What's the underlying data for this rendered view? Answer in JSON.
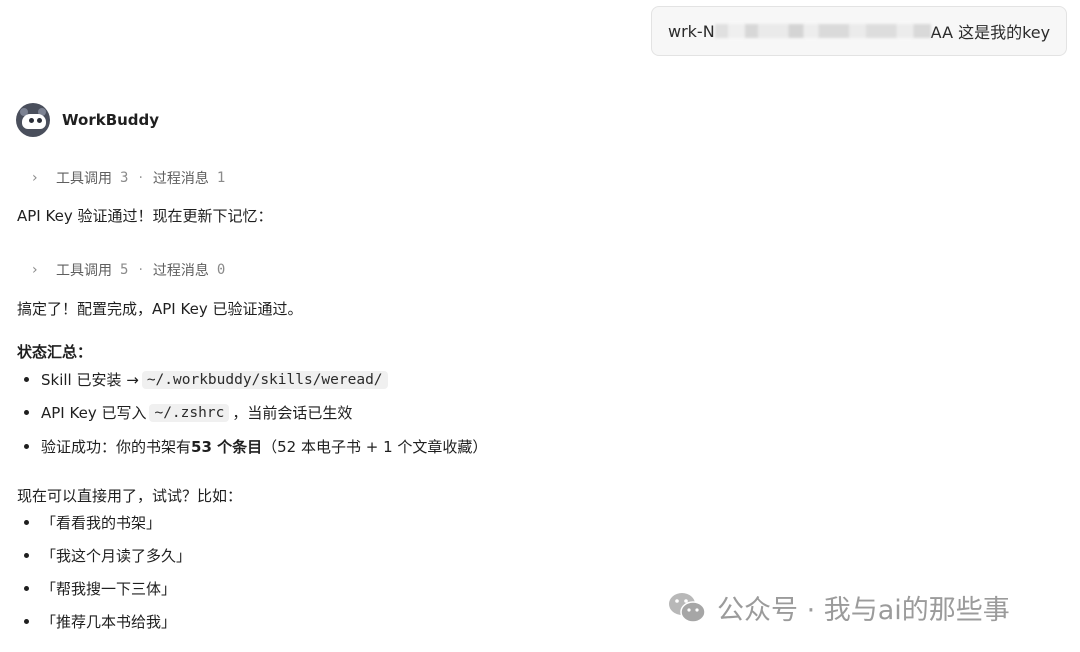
{
  "user_message": {
    "prefix": "wrk-N",
    "suffix": "AA 这是我的key"
  },
  "assistant": {
    "name": "WorkBuddy",
    "avatar_icon": "robot-avatar-icon"
  },
  "tool_rows": [
    {
      "label_calls": "工具调用",
      "calls": "3",
      "label_msgs": "过程消息",
      "msgs": "1"
    },
    {
      "label_calls": "工具调用",
      "calls": "5",
      "label_msgs": "过程消息",
      "msgs": "0"
    }
  ],
  "messages": {
    "verify_line": "API Key 验证通过！现在更新下记忆：",
    "done_line": "搞定了！配置完成，API Key 已验证通过。",
    "status_heading": "状态汇总：",
    "status_items": [
      {
        "before": "Skill 已安装 → ",
        "code": "~/.workbuddy/skills/weread/",
        "after": ""
      },
      {
        "before": "API Key 已写入 ",
        "code": "~/.zshrc",
        "after": "，当前会话已生效"
      },
      {
        "before": "验证成功：你的书架有 ",
        "bold": "53 个条目",
        "after": "（52 本电子书 + 1 个文章收藏）"
      }
    ],
    "try_heading": "现在可以直接用了，试试？比如：",
    "examples": [
      "「看看我的书架」",
      "「我这个月读了多久」",
      "「帮我搜一下三体」",
      "「推荐几本书给我」"
    ]
  },
  "watermark": {
    "text": "公众号 · 我与ai的那些事",
    "icon": "wechat-icon"
  }
}
